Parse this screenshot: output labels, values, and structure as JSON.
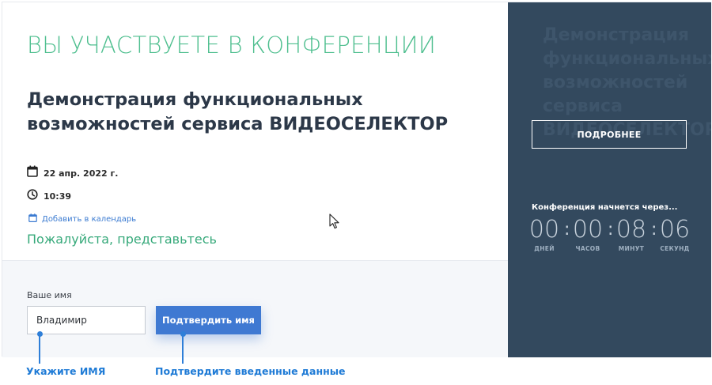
{
  "page": {
    "eyebrow": "ВЫ УЧАСТВУЕТЕ В КОНФЕРЕНЦИИ",
    "title": "Демонстрация функциональных возможностей сервиса ВИДЕОСЕЛЕКТОР",
    "date": "22 апр. 2022 г.",
    "time": "10:39",
    "add_to_calendar": "Добавить в календарь",
    "prompt": "Пожалуйста, представьтесь"
  },
  "form": {
    "name_label": "Ваше имя",
    "name_value": "Владимир",
    "confirm_label": "Подтвердить имя"
  },
  "sidebar": {
    "ghost_title": "Демонстрация функциональных возможностей сервиса ВИДЕОСЕЛЕКТОР",
    "more_label": "ПОДРОБНЕЕ",
    "starts_text": "Конференция начнется через...",
    "countdown": [
      {
        "value": "00",
        "unit": "ДНЕЙ"
      },
      {
        "value": "00",
        "unit": "ЧАСОВ"
      },
      {
        "value": "08",
        "unit": "МИНУТ"
      },
      {
        "value": "06",
        "unit": "СЕКУНД"
      }
    ],
    "separator": ":"
  },
  "annotations": {
    "enter_name": "Укажите ИМЯ",
    "confirm_data": "Подтвердите введенные данные"
  },
  "colors": {
    "accent_green": "#4fbf8f",
    "button_blue": "#3f79d2",
    "sidebar_bg": "#33495e",
    "annotation_blue": "#1f7bd6"
  },
  "icons": [
    "calendar-icon",
    "clock-icon",
    "calendar-small-icon",
    "mouse-cursor-icon"
  ]
}
